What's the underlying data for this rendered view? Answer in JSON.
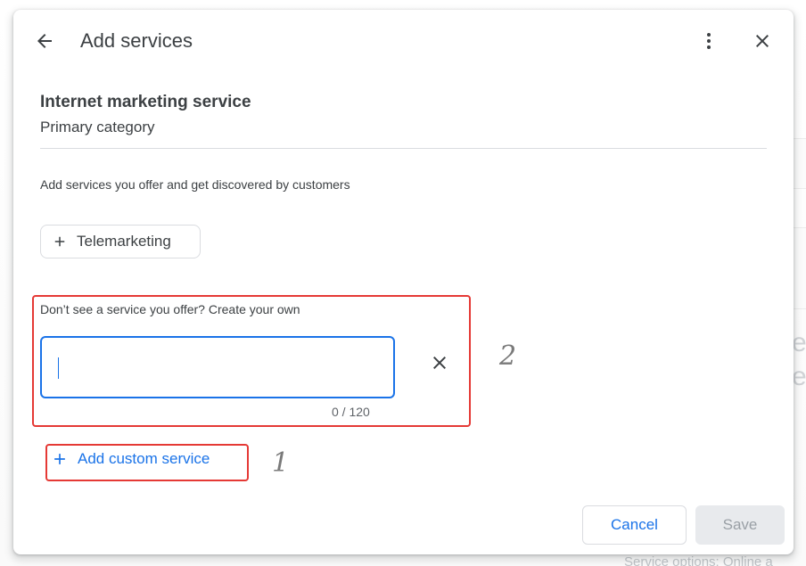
{
  "dialog": {
    "title": "Add services",
    "back_icon": "arrow-left-icon",
    "more_icon": "more-vert-icon",
    "close_icon": "close-icon"
  },
  "category": {
    "name": "Internet marketing service",
    "label": "Primary category"
  },
  "intro_text": "Add services you offer and get discovered by customers",
  "suggested_services": [
    {
      "label": "Telemarketing",
      "icon": "plus-icon"
    }
  ],
  "custom_service": {
    "prompt": "Don’t see a service you offer? Create your own",
    "value": "",
    "counter": "0 / 120",
    "clear_icon": "close-icon"
  },
  "add_custom_button": {
    "label": "Add custom service",
    "icon": "plus-icon"
  },
  "footer": {
    "cancel_label": "Cancel",
    "save_label": "Save"
  },
  "annotations": {
    "marker_1": "1",
    "marker_2": "2",
    "color": "#e53935"
  },
  "colors": {
    "accent": "#1a73e8",
    "text": "#3c4043",
    "border": "#dadce0",
    "disabled_bg": "#e8eaed",
    "disabled_text": "#9aa0a6"
  }
}
